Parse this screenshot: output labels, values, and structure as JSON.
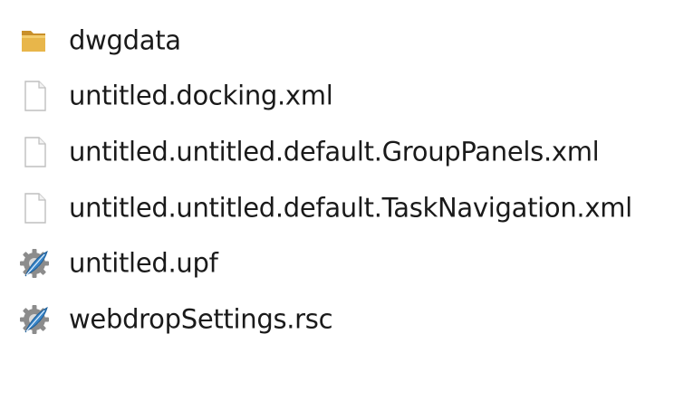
{
  "files": [
    {
      "name": "dwgdata",
      "icon": "folder-icon"
    },
    {
      "name": "untitled.docking.xml",
      "icon": "document-icon"
    },
    {
      "name": "untitled.untitled.default.GroupPanels.xml",
      "icon": "document-icon"
    },
    {
      "name": "untitled.untitled.default.TaskNavigation.xml",
      "icon": "document-icon"
    },
    {
      "name": "untitled.upf",
      "icon": "gear-feather-icon"
    },
    {
      "name": "webdropSettings.rsc",
      "icon": "gear-feather-icon"
    }
  ],
  "colors": {
    "folder": "#e8b64a",
    "folder_dark": "#c9902a",
    "document_border": "#bfbfbf",
    "gear": "#8c8c8c",
    "feather": "#3a86c8",
    "text": "#1a1a1a"
  }
}
